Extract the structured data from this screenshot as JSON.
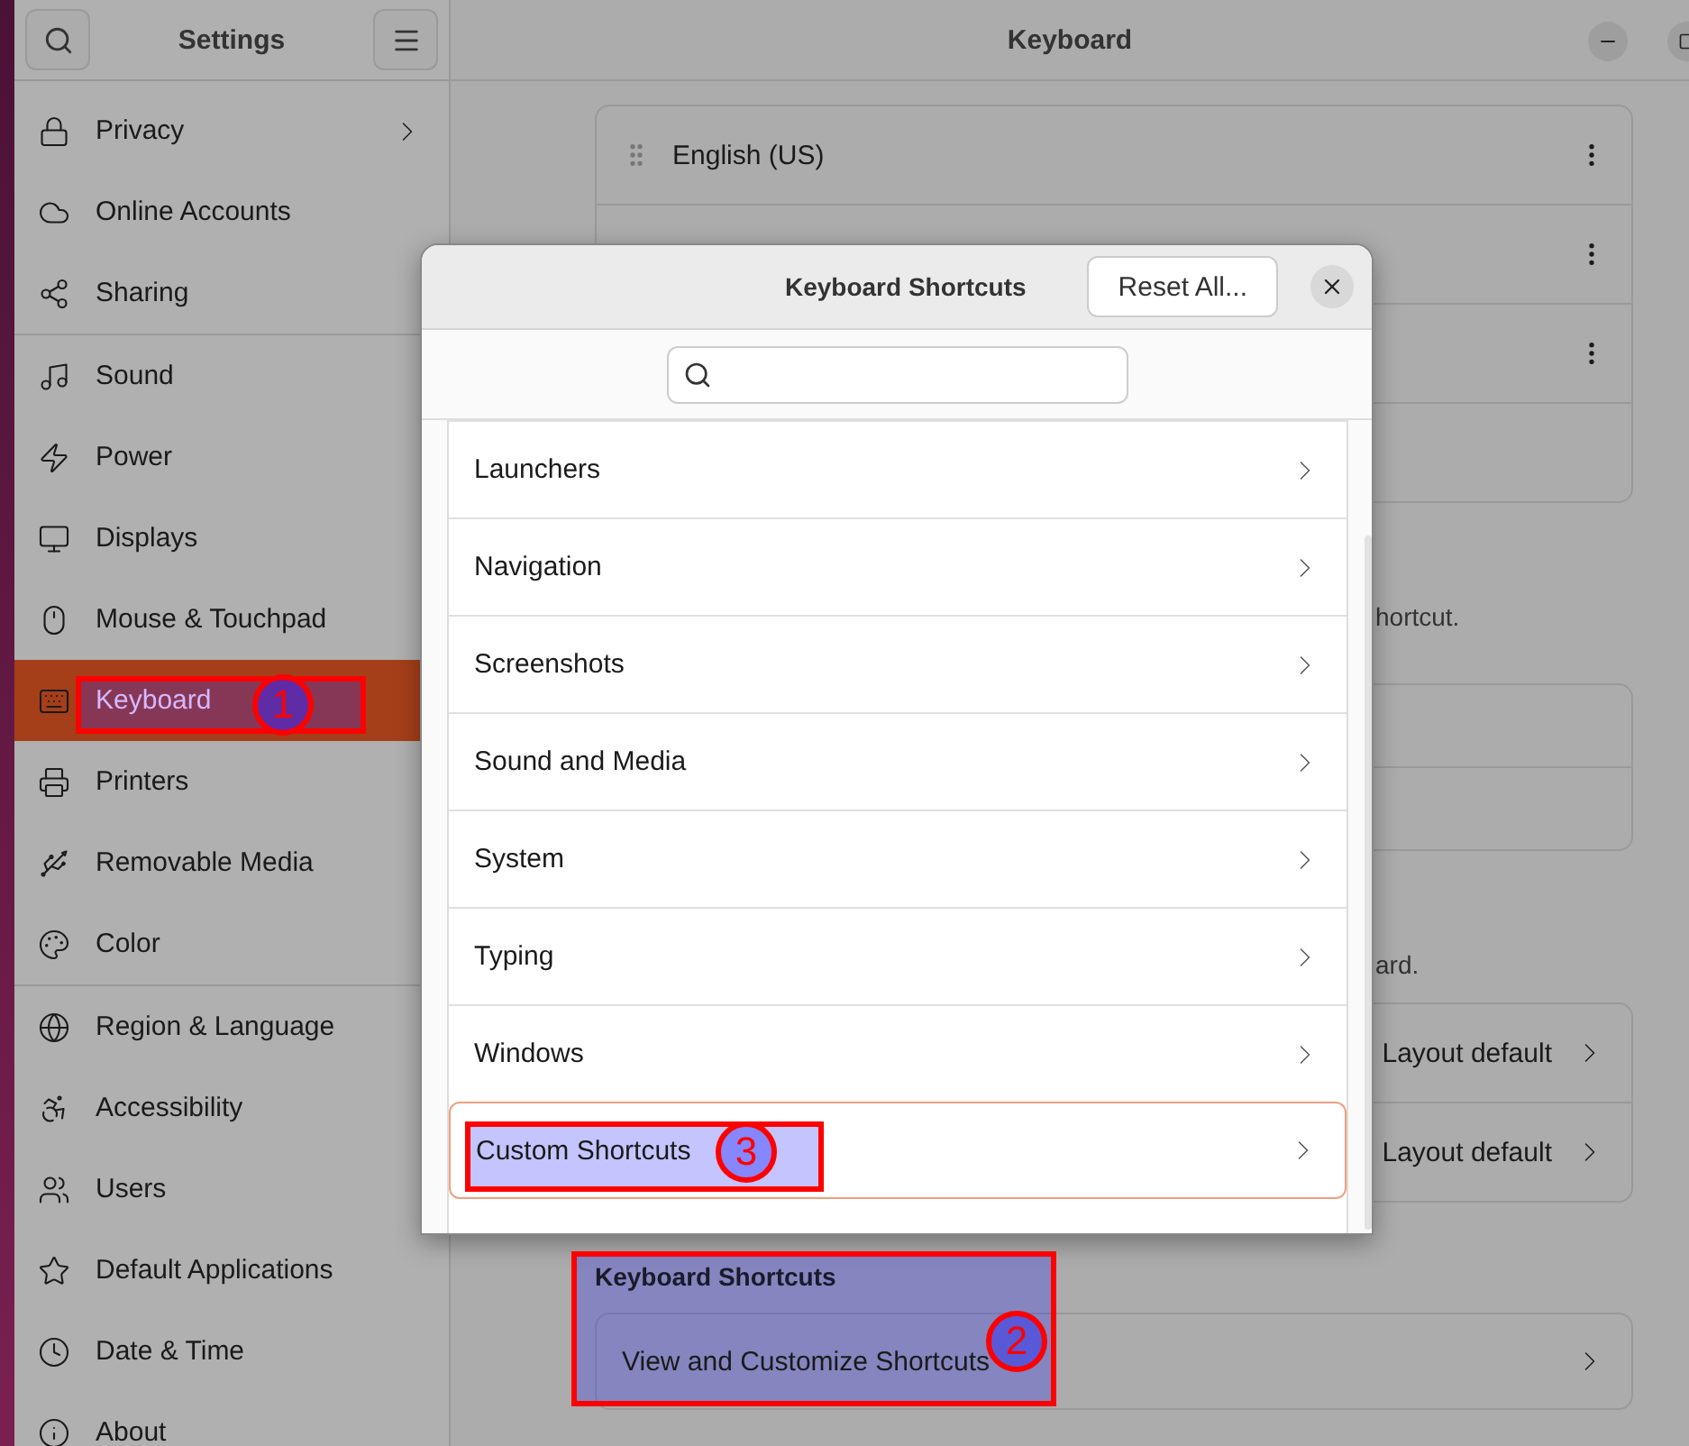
{
  "sidebar": {
    "title": "Settings",
    "groups": [
      [
        {
          "label": "Privacy",
          "submenu": true,
          "selected": false
        },
        {
          "label": "Online Accounts",
          "submenu": false,
          "selected": false
        },
        {
          "label": "Sharing",
          "submenu": false,
          "selected": false
        }
      ],
      [
        {
          "label": "Sound",
          "submenu": false,
          "selected": false
        },
        {
          "label": "Power",
          "submenu": false,
          "selected": false
        },
        {
          "label": "Displays",
          "submenu": false,
          "selected": false
        },
        {
          "label": "Mouse & Touchpad",
          "submenu": false,
          "selected": false
        },
        {
          "label": "Keyboard",
          "submenu": false,
          "selected": true
        },
        {
          "label": "Printers",
          "submenu": false,
          "selected": false
        },
        {
          "label": "Removable Media",
          "submenu": false,
          "selected": false
        },
        {
          "label": "Color",
          "submenu": false,
          "selected": false
        }
      ],
      [
        {
          "label": "Region & Language",
          "submenu": false,
          "selected": false
        },
        {
          "label": "Accessibility",
          "submenu": false,
          "selected": false
        },
        {
          "label": "Users",
          "submenu": false,
          "selected": false
        },
        {
          "label": "Default Applications",
          "submenu": false,
          "selected": false
        },
        {
          "label": "Date & Time",
          "submenu": false,
          "selected": false
        },
        {
          "label": "About",
          "submenu": false,
          "selected": false
        }
      ]
    ]
  },
  "main": {
    "title": "Keyboard",
    "input_sources": [
      {
        "label": "English (US)",
        "menu": true
      },
      {
        "menu": true
      },
      {
        "menu": true
      },
      {
        "menu": false
      }
    ],
    "note_1": "hortcut.",
    "note_2": "ard.",
    "layout_rows": [
      {
        "value": "Layout default"
      },
      {
        "value": "Layout default"
      }
    ],
    "shortcuts_heading": "Keyboard Shortcuts",
    "shortcuts_row": "View and Customize Shortcuts"
  },
  "dialog": {
    "title": "Keyboard Shortcuts",
    "reset_button": "Reset All...",
    "categories": [
      {
        "label": "Launchers",
        "focused": false
      },
      {
        "label": "Navigation",
        "focused": false
      },
      {
        "label": "Screenshots",
        "focused": false
      },
      {
        "label": "Sound and Media",
        "focused": false
      },
      {
        "label": "System",
        "focused": false
      },
      {
        "label": "Typing",
        "focused": false
      },
      {
        "label": "Windows",
        "focused": false
      },
      {
        "label": "Custom Shortcuts",
        "focused": true
      }
    ]
  },
  "annotations": [
    {
      "label": "1"
    },
    {
      "label": "2"
    },
    {
      "label": "3"
    }
  ]
}
